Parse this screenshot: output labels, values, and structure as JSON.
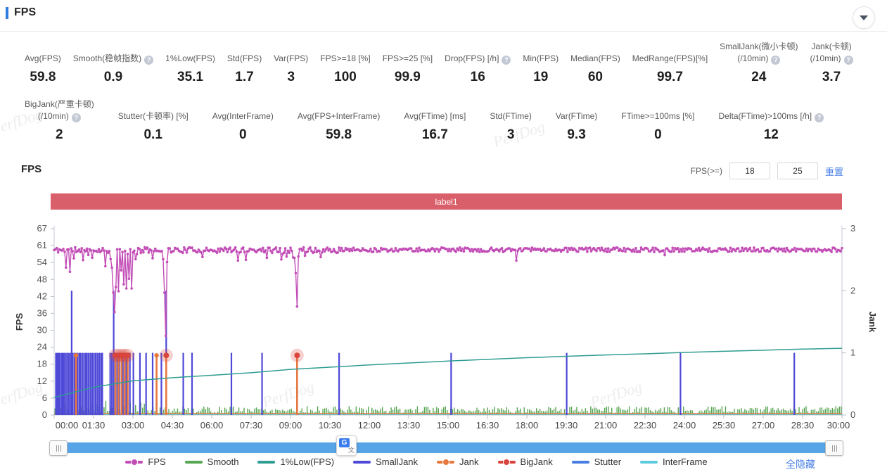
{
  "header": {
    "title": "FPS"
  },
  "section": {
    "title": "FPS",
    "filter_label": "FPS(>=)",
    "filter_value1": "18",
    "filter_value2": "25",
    "reset_label": "重置"
  },
  "stats": {
    "row1": [
      {
        "key": "avg-fps",
        "label": [
          "Avg(FPS)"
        ],
        "help": false,
        "value": "59.8"
      },
      {
        "key": "smooth",
        "label": [
          "Smooth(稳帧指数)"
        ],
        "help": true,
        "value": "0.9"
      },
      {
        "key": "low1-fps",
        "label": [
          "1%Low(FPS)"
        ],
        "help": false,
        "value": "35.1"
      },
      {
        "key": "std-fps",
        "label": [
          "Std(FPS)"
        ],
        "help": false,
        "value": "1.7"
      },
      {
        "key": "var-fps",
        "label": [
          "Var(FPS)"
        ],
        "help": false,
        "value": "3"
      },
      {
        "key": "fps-ge-18",
        "label": [
          "FPS>=18 [%]"
        ],
        "help": false,
        "value": "100"
      },
      {
        "key": "fps-ge-25",
        "label": [
          "FPS>=25 [%]"
        ],
        "help": false,
        "value": "99.9"
      },
      {
        "key": "drop-fps",
        "label": [
          "Drop(FPS) [/h]"
        ],
        "help": true,
        "value": "16"
      },
      {
        "key": "min-fps",
        "label": [
          "Min(FPS)"
        ],
        "help": false,
        "value": "19"
      },
      {
        "key": "median-fps",
        "label": [
          "Median(FPS)"
        ],
        "help": false,
        "value": "60"
      },
      {
        "key": "medrange-fps",
        "label": [
          "MedRange(FPS)[%]"
        ],
        "help": false,
        "value": "99.7"
      },
      {
        "key": "smalljank",
        "label": [
          "SmallJank(微小卡顿)",
          "(/10min)"
        ],
        "help": true,
        "value": "24"
      },
      {
        "key": "jank",
        "label": [
          "Jank(卡顿)",
          "(/10min)"
        ],
        "help": true,
        "value": "3.7"
      }
    ],
    "row2": [
      {
        "key": "bigjank",
        "label": [
          "BigJank(严重卡顿)",
          "(/10min)"
        ],
        "help": true,
        "value": "2"
      },
      {
        "key": "stutter",
        "label": [
          "Stutter(卡顿率) [%]"
        ],
        "help": false,
        "value": "0.1"
      },
      {
        "key": "avg-interframe",
        "label": [
          "Avg(InterFrame)"
        ],
        "help": false,
        "value": "0"
      },
      {
        "key": "avg-fps-interframe",
        "label": [
          "Avg(FPS+InterFrame)"
        ],
        "help": false,
        "value": "59.8"
      },
      {
        "key": "avg-ftime",
        "label": [
          "Avg(FTime) [ms]"
        ],
        "help": false,
        "value": "16.7"
      },
      {
        "key": "std-ftime",
        "label": [
          "Std(FTime)"
        ],
        "help": false,
        "value": "3"
      },
      {
        "key": "var-ftime",
        "label": [
          "Var(FTime)"
        ],
        "help": false,
        "value": "9.3"
      },
      {
        "key": "ftime-ge-100ms",
        "label": [
          "FTime>=100ms [%]"
        ],
        "help": false,
        "value": "0"
      },
      {
        "key": "delta-ftime",
        "label": [
          "Delta(FTime)>100ms [/h]"
        ],
        "help": true,
        "value": "12"
      }
    ]
  },
  "chart_data": {
    "type": "line",
    "annotation_label": "label1",
    "duration_seconds": 1800,
    "x_ticks": [
      "00:00",
      "01:30",
      "03:00",
      "04:30",
      "06:00",
      "07:30",
      "09:00",
      "10:30",
      "12:00",
      "13:30",
      "15:00",
      "16:30",
      "18:00",
      "19:30",
      "21:00",
      "22:30",
      "24:00",
      "25:30",
      "27:00",
      "28:30",
      "30:00"
    ],
    "y_left": {
      "label": "FPS",
      "ticks": [
        0,
        6,
        12,
        18,
        24,
        30,
        36,
        42,
        48,
        54,
        61,
        67
      ],
      "max": 67
    },
    "y_right": {
      "label": "Jank",
      "ticks": [
        0,
        1,
        2,
        3
      ],
      "max": 3
    },
    "legend_position": "bottom",
    "grid": false,
    "series": [
      {
        "name": "FPS",
        "axis": "left",
        "color": "#c24db6",
        "style": "line-markers",
        "sample_step_s": 3,
        "baseline": 59.3,
        "noise": 1.0,
        "seed": 11,
        "dips": [
          [
            28,
            53
          ],
          [
            36,
            51.5
          ],
          [
            118,
            53.5
          ],
          [
            133,
            53
          ],
          [
            136,
            44
          ],
          [
            139,
            37
          ],
          [
            142,
            46
          ],
          [
            148,
            44.5
          ],
          [
            152,
            52
          ],
          [
            158,
            47
          ],
          [
            164,
            45.5
          ],
          [
            170,
            49
          ],
          [
            176,
            45.5
          ],
          [
            186,
            56
          ],
          [
            250,
            56
          ],
          [
            253,
            44
          ],
          [
            256,
            28.5
          ],
          [
            259,
            55
          ],
          [
            420,
            55.5
          ],
          [
            548,
            56.5
          ],
          [
            552,
            51
          ],
          [
            555,
            39
          ],
          [
            558,
            57
          ],
          [
            1055,
            55.5
          ],
          [
            1395,
            57.5
          ]
        ]
      },
      {
        "name": "Smooth",
        "axis": "left",
        "color": "#56a652",
        "style": "bars",
        "sample_step_s": 4,
        "min": 0.6,
        "max": 3.2,
        "seed": 5
      },
      {
        "name": "1%Low(FPS)",
        "axis": "left",
        "color": "#2f9d92",
        "style": "line",
        "points": [
          [
            0,
            6.3
          ],
          [
            90,
            10
          ],
          [
            180,
            12.3
          ],
          [
            270,
            13.4
          ],
          [
            360,
            14.3
          ],
          [
            450,
            15.2
          ],
          [
            540,
            16.4
          ],
          [
            630,
            17.2
          ],
          [
            720,
            18
          ],
          [
            810,
            18.7
          ],
          [
            900,
            19.4
          ],
          [
            990,
            20
          ],
          [
            1080,
            20.6
          ],
          [
            1170,
            21.1
          ],
          [
            1260,
            21.6
          ],
          [
            1350,
            22
          ],
          [
            1440,
            22.5
          ],
          [
            1530,
            22.9
          ],
          [
            1620,
            23.3
          ],
          [
            1710,
            23.7
          ],
          [
            1800,
            24
          ]
        ]
      },
      {
        "name": "SmallJank",
        "axis": "right",
        "color": "#4f49d8",
        "style": "spikes",
        "value": 1,
        "times": [
          4,
          7,
          10,
          13,
          17,
          20,
          23,
          27,
          31,
          34,
          38,
          42,
          46,
          49,
          53,
          57,
          60,
          64,
          68,
          72,
          75,
          79,
          83,
          87,
          91,
          95,
          99,
          103,
          107,
          110,
          128,
          132,
          141,
          145,
          149,
          157,
          165,
          173,
          181,
          196,
          210,
          225,
          245,
          295,
          315,
          405,
          475,
          555,
          651,
          907,
          1171,
          1431,
          1691
        ],
        "tall": [
          [
            40,
            2
          ],
          [
            136,
            2
          ],
          [
            256,
            2
          ]
        ]
      },
      {
        "name": "Jank",
        "axis": "right",
        "color": "#e8793e",
        "style": "spikes-dot",
        "value": 0.96,
        "baseline": 0,
        "times": [
          50,
          140,
          147,
          154,
          161,
          168,
          234,
          256,
          555
        ],
        "dot_only_times": [
          50,
          234
        ]
      },
      {
        "name": "BigJank",
        "axis": "right",
        "color": "#d9453d",
        "halo": "rgba(217,69,61,0.25)",
        "style": "dots",
        "value": 0.96,
        "times": [
          140,
          147,
          154,
          161,
          168,
          256,
          555
        ]
      },
      {
        "name": "Stutter",
        "axis": "right",
        "color": "#6fa7e8",
        "style": "spikes",
        "value": 0.24,
        "times": [
          50,
          140,
          147,
          154,
          161,
          168,
          234,
          256,
          555
        ]
      },
      {
        "name": "InterFrame",
        "axis": "right",
        "color": "#5fcade",
        "style": "baseline",
        "value": 0
      }
    ]
  },
  "legend": {
    "items": [
      {
        "label": "FPS",
        "color": "#c24db6",
        "dot": true
      },
      {
        "label": "Smooth",
        "color": "#56a652",
        "dot": false
      },
      {
        "label": "1%Low(FPS)",
        "color": "#2f9d92",
        "dot": false
      },
      {
        "label": "SmallJank",
        "color": "#4f49d8",
        "dot": false
      },
      {
        "label": "Jank",
        "color": "#e8793e",
        "dot": true
      },
      {
        "label": "BigJank",
        "color": "#d9453d",
        "dot": true
      },
      {
        "label": "Stutter",
        "color": "#4a7de2",
        "dot": false
      },
      {
        "label": "InterFrame",
        "color": "#5fcade",
        "dot": false
      }
    ],
    "hide_all_label": "全隐藏"
  },
  "watermark": {
    "text": "PerfDog"
  },
  "colors": {
    "accent_blue": "#2f7ce0",
    "link_blue": "#4a7fe8",
    "annotation_red": "#d9606b",
    "scrollbar_blue": "#57a4e6"
  }
}
